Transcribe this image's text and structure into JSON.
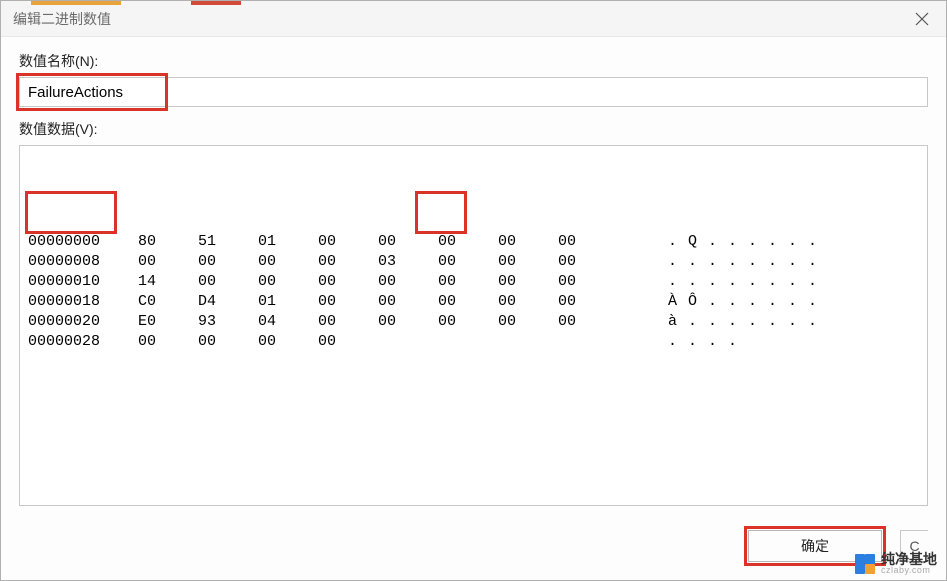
{
  "window": {
    "title": "编辑二进制数值"
  },
  "labels": {
    "name_label": "数值名称(N):",
    "data_label": "数值数据(V):"
  },
  "fields": {
    "name_value": "FailureActions"
  },
  "hex": {
    "rows": [
      {
        "offset": "00000000",
        "bytes": [
          "80",
          "51",
          "01",
          "00",
          "00",
          "00",
          "00",
          "00"
        ],
        "ascii": [
          ".",
          "Q",
          ".",
          ".",
          ".",
          ".",
          ".",
          "."
        ]
      },
      {
        "offset": "00000008",
        "bytes": [
          "00",
          "00",
          "00",
          "00",
          "03",
          "00",
          "00",
          "00"
        ],
        "ascii": [
          ".",
          ".",
          ".",
          ".",
          ".",
          ".",
          ".",
          "."
        ]
      },
      {
        "offset": "00000010",
        "bytes": [
          "14",
          "00",
          "00",
          "00",
          "00",
          "00",
          "00",
          "00"
        ],
        "ascii": [
          ".",
          ".",
          ".",
          ".",
          ".",
          ".",
          ".",
          "."
        ]
      },
      {
        "offset": "00000018",
        "bytes": [
          "C0",
          "D4",
          "01",
          "00",
          "00",
          "00",
          "00",
          "00"
        ],
        "ascii": [
          "À",
          "Ô",
          ".",
          ".",
          ".",
          ".",
          ".",
          "."
        ]
      },
      {
        "offset": "00000020",
        "bytes": [
          "E0",
          "93",
          "04",
          "00",
          "00",
          "00",
          "00",
          "00"
        ],
        "ascii": [
          "à",
          ".",
          ".",
          ".",
          ".",
          ".",
          ".",
          "."
        ]
      },
      {
        "offset": "00000028",
        "bytes": [
          "00",
          "00",
          "00",
          "00"
        ],
        "ascii": [
          ".",
          ".",
          ".",
          "."
        ]
      }
    ]
  },
  "buttons": {
    "ok": "确定",
    "cancel_visible": "C"
  },
  "watermark": {
    "name": "纯净基地",
    "url": "czlaby.com"
  }
}
